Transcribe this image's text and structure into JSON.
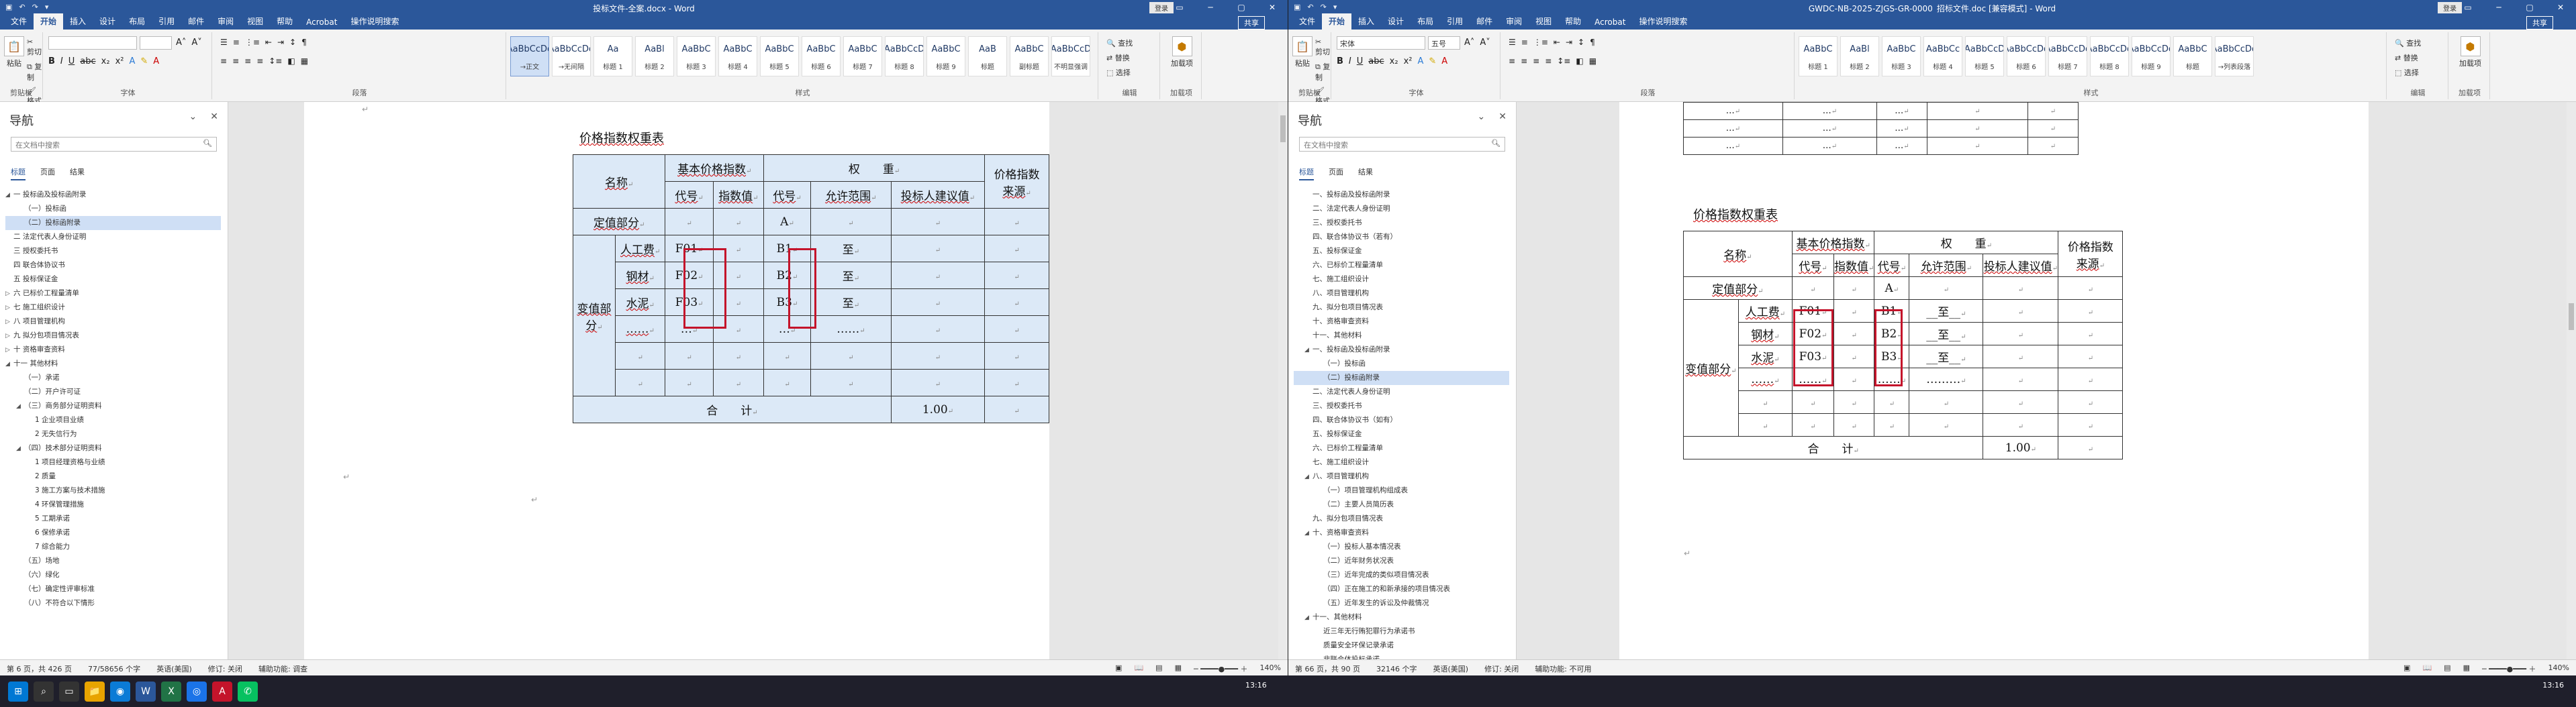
{
  "left": {
    "title": "投标文件-全案.docx - Word",
    "user": "登录",
    "tabs": [
      "文件",
      "开始",
      "插入",
      "设计",
      "布局",
      "引用",
      "邮件",
      "审阅",
      "视图",
      "帮助",
      "Acrobat",
      "操作说明搜索"
    ],
    "share": "共享",
    "font_name": "",
    "font_size": "",
    "styles": [
      {
        "sample": "AaBbCcDd",
        "name": "→正文"
      },
      {
        "sample": "AaBbCcDd",
        "name": "→无间隔"
      },
      {
        "sample": "Aa",
        "name": "标题 1"
      },
      {
        "sample": "AaBl",
        "name": "标题 2"
      },
      {
        "sample": "AaBbC",
        "name": "标题 3"
      },
      {
        "sample": "AaBbC",
        "name": "标题 4"
      },
      {
        "sample": "AaBbC",
        "name": "标题 5"
      },
      {
        "sample": "AaBbC",
        "name": "标题 6"
      },
      {
        "sample": "AaBbC",
        "name": "标题 7"
      },
      {
        "sample": "AaBbCcD",
        "name": "标题 8"
      },
      {
        "sample": "AaBbC",
        "name": "标题 9"
      },
      {
        "sample": "AaB",
        "name": "标题"
      },
      {
        "sample": "AaBbC",
        "name": "副标题"
      },
      {
        "sample": "AaBbCcD",
        "name": "不明显强调"
      }
    ],
    "group_labels": {
      "clipboard": "剪贴板",
      "font": "字体",
      "para": "段落",
      "styles": "样式",
      "edit": "编辑",
      "addin": "加载项"
    },
    "clipboard": {
      "paste": "粘贴",
      "cut": "剪切",
      "copy": "复制",
      "painter": "格式刷"
    },
    "edit": {
      "find": "查找",
      "replace": "替换",
      "select": "选择"
    },
    "addin": {
      "label": "加载项"
    },
    "nav": {
      "heading": "导航",
      "search_placeholder": "在文档中搜索",
      "tabs": [
        "标题",
        "页面",
        "结果"
      ],
      "items": [
        {
          "t": "一 投标函及投标函附录",
          "lv": 1,
          "tw": "◢"
        },
        {
          "t": "（一）投标函",
          "lv": 2,
          "tw": ""
        },
        {
          "t": "（二）投标函附录",
          "lv": 2,
          "tw": "",
          "sel": true
        },
        {
          "t": "二 法定代表人身份证明",
          "lv": 1,
          "tw": ""
        },
        {
          "t": "三 授权委托书",
          "lv": 1,
          "tw": ""
        },
        {
          "t": "四 联合体协议书",
          "lv": 1,
          "tw": ""
        },
        {
          "t": "五 投标保证金",
          "lv": 1,
          "tw": ""
        },
        {
          "t": "六 已标价工程量清单",
          "lv": 1,
          "tw": "▷"
        },
        {
          "t": "七 施工组织设计",
          "lv": 1,
          "tw": "▷"
        },
        {
          "t": "八 项目管理机构",
          "lv": 1,
          "tw": "▷"
        },
        {
          "t": "九 拟分包项目情况表",
          "lv": 1,
          "tw": "▷"
        },
        {
          "t": "十 资格审查资料",
          "lv": 1,
          "tw": "▷"
        },
        {
          "t": "十一 其他材料",
          "lv": 1,
          "tw": "◢"
        },
        {
          "t": "（一）承诺",
          "lv": 2,
          "tw": ""
        },
        {
          "t": "（二）开户许可证",
          "lv": 2,
          "tw": ""
        },
        {
          "t": "（三）商务部分证明资料",
          "lv": 2,
          "tw": "◢"
        },
        {
          "t": "1 企业项目业绩",
          "lv": 3,
          "tw": ""
        },
        {
          "t": "2 无失信行为",
          "lv": 3,
          "tw": ""
        },
        {
          "t": "（四）技术部分证明资料",
          "lv": 2,
          "tw": "◢"
        },
        {
          "t": "1 项目经理资格与业绩",
          "lv": 3,
          "tw": ""
        },
        {
          "t": "2 质量",
          "lv": 3,
          "tw": ""
        },
        {
          "t": "3 施工方案与技术措施",
          "lv": 3,
          "tw": ""
        },
        {
          "t": "4 环保管理措施",
          "lv": 3,
          "tw": ""
        },
        {
          "t": "5 工期承诺",
          "lv": 3,
          "tw": ""
        },
        {
          "t": "6 保修承诺",
          "lv": 3,
          "tw": ""
        },
        {
          "t": "7 综合能力",
          "lv": 3,
          "tw": ""
        },
        {
          "t": "（五）场地",
          "lv": 2,
          "tw": ""
        },
        {
          "t": "（六）绿化",
          "lv": 2,
          "tw": ""
        },
        {
          "t": "（七）确定性评审标准",
          "lv": 2,
          "tw": ""
        },
        {
          "t": "（八）不符合以下情形",
          "lv": 2,
          "tw": ""
        }
      ]
    },
    "doc": {
      "caption": "价格指数权重表",
      "h": {
        "name": "名称",
        "base": "基本价格指数",
        "weight": "权　　重",
        "price_source": "价格指数",
        "source2": "来源",
        "code": "代号",
        "index_val": "指数值",
        "code2": "代号",
        "range": "允许范围",
        "bidder": "投标人建议值"
      },
      "fixed": {
        "label": "定值部分",
        "code": "A"
      },
      "variable_label": "变值部分",
      "rows": [
        {
          "name": "人工费",
          "code": "F01",
          "bcode": "B1",
          "range": "至"
        },
        {
          "name": "钢材",
          "code": "F02",
          "bcode": "B2",
          "range": "至"
        },
        {
          "name": "水泥",
          "code": "F03",
          "bcode": "B3",
          "range": "至"
        },
        {
          "name": "……",
          "code": "…",
          "bcode": "…",
          "range": "……"
        }
      ],
      "total": {
        "label": "合　　计",
        "value": "1.00"
      }
    },
    "status": {
      "left": [
        "第 6 页，共 426 页",
        "77/58656 个字",
        "英语(美国)",
        "修订: 关闭",
        "辅助功能: 调查"
      ],
      "right": [
        "",
        "",
        "",
        "",
        "140%"
      ]
    }
  },
  "right": {
    "title": "GWDC-NB-2025-ZJGS-GR-0000 招标文件.doc [兼容模式] - Word",
    "user": "登录",
    "tabs": [
      "文件",
      "开始",
      "插入",
      "设计",
      "布局",
      "引用",
      "邮件",
      "审阅",
      "视图",
      "帮助",
      "Acrobat",
      "操作说明搜索"
    ],
    "share": "共享",
    "font_name": "宋体",
    "font_size": "五号",
    "styles": [
      {
        "sample": "AaBbC",
        "name": "标题 1"
      },
      {
        "sample": "AaBl",
        "name": "标题 2"
      },
      {
        "sample": "AaBbC",
        "name": "标题 3"
      },
      {
        "sample": "AaBbCc",
        "name": "标题 4"
      },
      {
        "sample": "AaBbCcD",
        "name": "标题 5"
      },
      {
        "sample": "AaBbCcDd",
        "name": "标题 6"
      },
      {
        "sample": "AaBbCcDd",
        "name": "标题 7"
      },
      {
        "sample": "AaBbCcDd",
        "name": "标题 8"
      },
      {
        "sample": "AaBbCcDd",
        "name": "标题 9"
      },
      {
        "sample": "AaBbC",
        "name": "标题"
      },
      {
        "sample": "AaBbCcDd",
        "name": "→列表段落"
      }
    ],
    "group_labels": {
      "clipboard": "剪贴板",
      "font": "字体",
      "para": "段落",
      "styles": "样式",
      "edit": "编辑",
      "addin": "加载项"
    },
    "clipboard": {
      "paste": "粘贴",
      "cut": "剪切",
      "copy": "复制",
      "painter": "格式刷"
    },
    "edit": {
      "find": "查找",
      "replace": "替换",
      "select": "选择"
    },
    "addin": {
      "label": "加载项"
    },
    "nav": {
      "heading": "导航",
      "search_placeholder": "在文档中搜索",
      "tabs": [
        "标题",
        "页面",
        "结果"
      ],
      "items": [
        {
          "t": "一、投标函及投标函附录",
          "lv": 2,
          "tw": ""
        },
        {
          "t": "二、法定代表人身份证明",
          "lv": 2,
          "tw": ""
        },
        {
          "t": "三、授权委托书",
          "lv": 2,
          "tw": ""
        },
        {
          "t": "四、联合体协议书（若有）",
          "lv": 2,
          "tw": ""
        },
        {
          "t": "五、投标保证金",
          "lv": 2,
          "tw": ""
        },
        {
          "t": "六、已标价工程量清单",
          "lv": 2,
          "tw": ""
        },
        {
          "t": "七、施工组织设计",
          "lv": 2,
          "tw": ""
        },
        {
          "t": "八、项目管理机构",
          "lv": 2,
          "tw": ""
        },
        {
          "t": "九、拟分包项目情况表",
          "lv": 2,
          "tw": ""
        },
        {
          "t": "十、资格审查资料",
          "lv": 2,
          "tw": ""
        },
        {
          "t": "十一、其他材料",
          "lv": 2,
          "tw": ""
        },
        {
          "t": "一、投标函及投标函附录",
          "lv": 2,
          "tw": "◢"
        },
        {
          "t": "（一）投标函",
          "lv": 3,
          "tw": ""
        },
        {
          "t": "（二）投标函附录",
          "lv": 3,
          "tw": "",
          "sel": true
        },
        {
          "t": "二、法定代表人身份证明",
          "lv": 2,
          "tw": ""
        },
        {
          "t": "三、授权委托书",
          "lv": 2,
          "tw": ""
        },
        {
          "t": "四、联合体协议书（如有）",
          "lv": 2,
          "tw": ""
        },
        {
          "t": "五、投标保证金",
          "lv": 2,
          "tw": ""
        },
        {
          "t": "六、已标价工程量清单",
          "lv": 2,
          "tw": ""
        },
        {
          "t": "七、施工组织设计",
          "lv": 2,
          "tw": ""
        },
        {
          "t": "八、项目管理机构",
          "lv": 2,
          "tw": "◢"
        },
        {
          "t": "（一）项目管理机构组成表",
          "lv": 3,
          "tw": ""
        },
        {
          "t": "（二）主要人员简历表",
          "lv": 3,
          "tw": ""
        },
        {
          "t": "九、拟分包项目情况表",
          "lv": 2,
          "tw": ""
        },
        {
          "t": "十、资格审查资料",
          "lv": 2,
          "tw": "◢"
        },
        {
          "t": "（一）投标人基本情况表",
          "lv": 3,
          "tw": ""
        },
        {
          "t": "（二）近年财务状况表",
          "lv": 3,
          "tw": ""
        },
        {
          "t": "（三）近年完成的类似项目情况表",
          "lv": 3,
          "tw": ""
        },
        {
          "t": "（四）正在施工的和新承接的项目情况表",
          "lv": 3,
          "tw": ""
        },
        {
          "t": "（五）近年发生的诉讼及仲裁情况",
          "lv": 3,
          "tw": ""
        },
        {
          "t": "十一、其他材料",
          "lv": 2,
          "tw": "◢"
        },
        {
          "t": "近三年无行贿犯罪行为承诺书",
          "lv": 3,
          "tw": ""
        },
        {
          "t": "质量安全环保记录承诺",
          "lv": 3,
          "tw": ""
        },
        {
          "t": "非联合体投标承诺",
          "lv": 3,
          "tw": ""
        }
      ]
    },
    "doc": {
      "caption": "价格指数权重表",
      "h": {
        "name": "名称",
        "base": "基本价格指数",
        "weight": "权　　重",
        "price_source": "价格指数",
        "source2": "来源",
        "code": "代号",
        "index_val": "指数值",
        "code2": "代号",
        "range": "允许范围",
        "bidder": "投标人建议值"
      },
      "fixed": {
        "label": "定值部分",
        "code": "A"
      },
      "variable_label": "变值部分",
      "rows": [
        {
          "name": "人工费",
          "code": "F01",
          "bcode": "B1",
          "range": "__至__"
        },
        {
          "name": "钢材",
          "code": "F02",
          "bcode": "B2",
          "range": "__至__"
        },
        {
          "name": "水泥",
          "code": "F03",
          "bcode": "B3",
          "range": "__至__"
        },
        {
          "name": "……",
          "code": "……",
          "bcode": "……",
          "range": "………"
        }
      ],
      "total": {
        "label": "合　　计",
        "value": "1.00"
      },
      "prev_dots": "…"
    },
    "status": {
      "left": [
        "第 66 页，共 90 页",
        "32146 个字",
        "英语(美国)",
        "修订: 关闭",
        "辅助功能: 不可用"
      ],
      "right": [
        "",
        "",
        "",
        "",
        "140%"
      ]
    }
  },
  "taskbar": {
    "time1": "13:16",
    "time2": "13:16"
  }
}
